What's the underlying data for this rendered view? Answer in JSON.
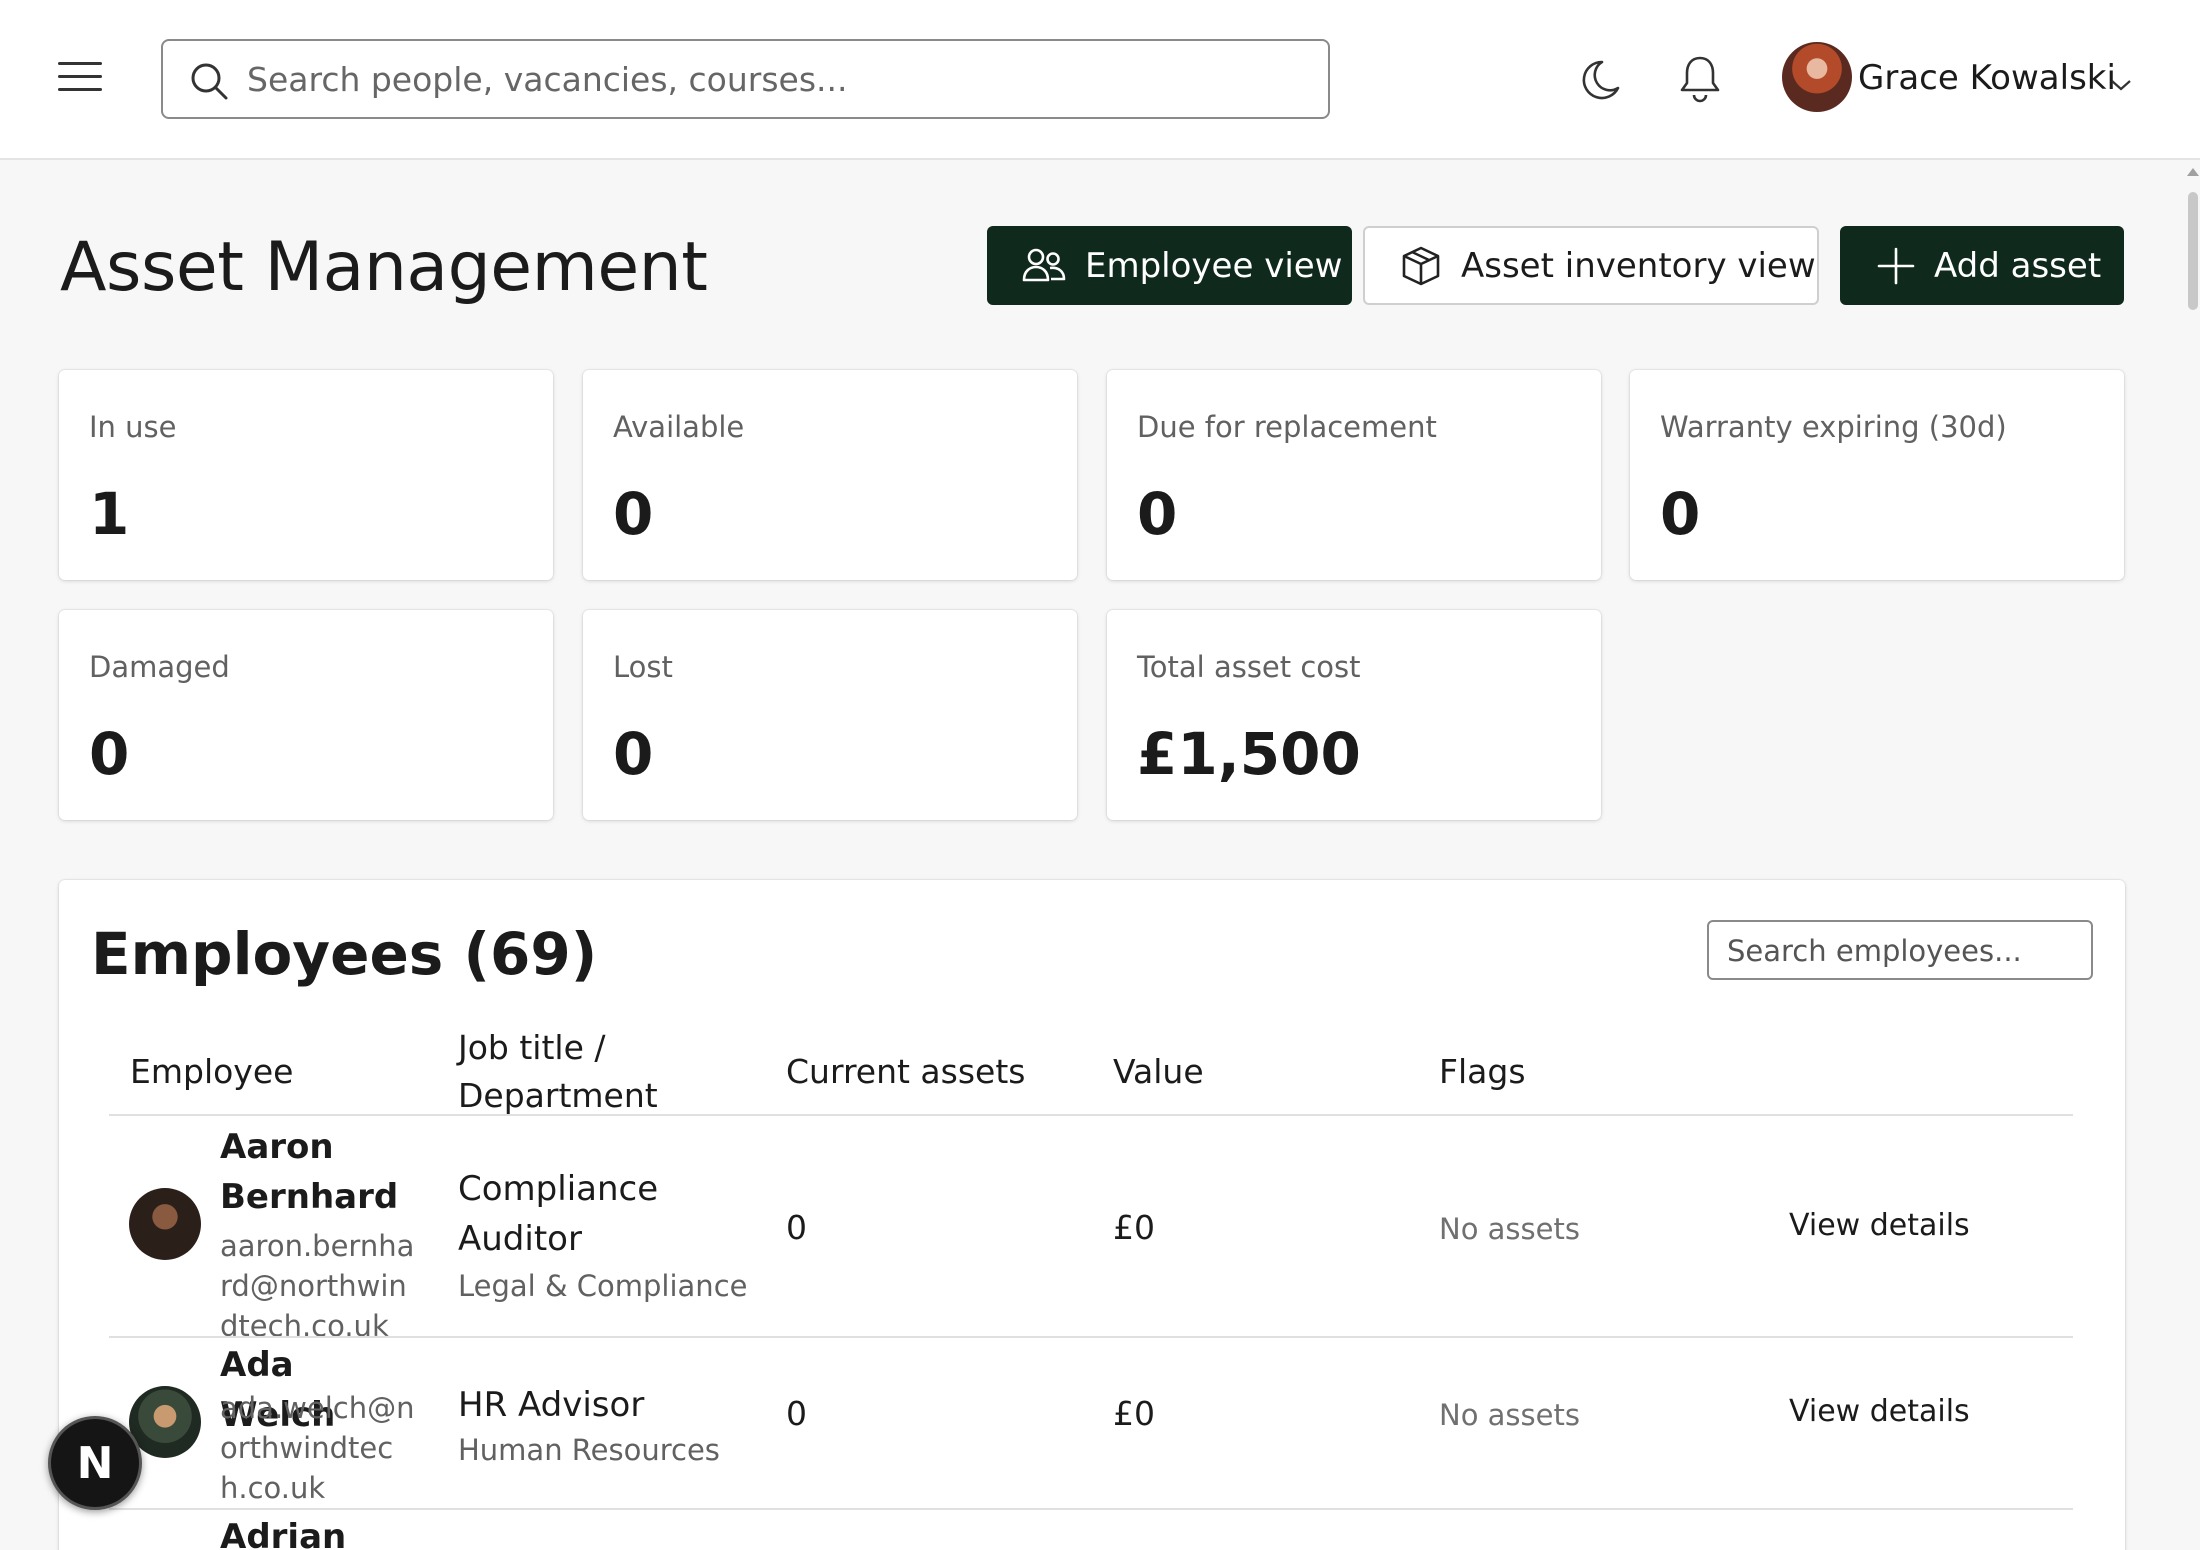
{
  "header": {
    "search_placeholder": "Search people, vacancies, courses...",
    "user_name": "Grace Kowalski"
  },
  "page": {
    "title": "Asset Management",
    "buttons": {
      "employee_view": "Employee view",
      "asset_inventory_view": "Asset inventory view",
      "add_asset": "Add asset"
    }
  },
  "stats": [
    {
      "label": "In use",
      "value": "1"
    },
    {
      "label": "Available",
      "value": "0"
    },
    {
      "label": "Due for replacement",
      "value": "0"
    },
    {
      "label": "Warranty expiring (30d)",
      "value": "0"
    },
    {
      "label": "Damaged",
      "value": "0"
    },
    {
      "label": "Lost",
      "value": "0"
    },
    {
      "label": "Total asset cost",
      "value": "£1,500"
    }
  ],
  "employees": {
    "title": "Employees (69)",
    "search_placeholder": "Search employees...",
    "columns": {
      "employee": "Employee",
      "job_title": "Job title / Department",
      "current_assets": "Current assets",
      "value": "Value",
      "flags": "Flags"
    },
    "rows": [
      {
        "name": "Aaron Bernhard",
        "email": "aaron.bernhard@northwindtech.co.uk",
        "job_title": "Compliance Auditor",
        "department": "Legal & Compliance",
        "current_assets": "0",
        "value": "£0",
        "flags": "No assets",
        "action": "View details"
      },
      {
        "name": "Ada Welch",
        "email": "ada.welch@northwindtech.co.uk",
        "job_title": "HR Advisor",
        "department": "Human Resources",
        "current_assets": "0",
        "value": "£0",
        "flags": "No assets",
        "action": "View details"
      },
      {
        "name": "Adrian"
      }
    ]
  },
  "badge": {
    "letter": "N"
  },
  "colors": {
    "primary_dark": "#0f2a1c",
    "page_bg": "#f7f7f7",
    "muted_text": "#616161"
  }
}
